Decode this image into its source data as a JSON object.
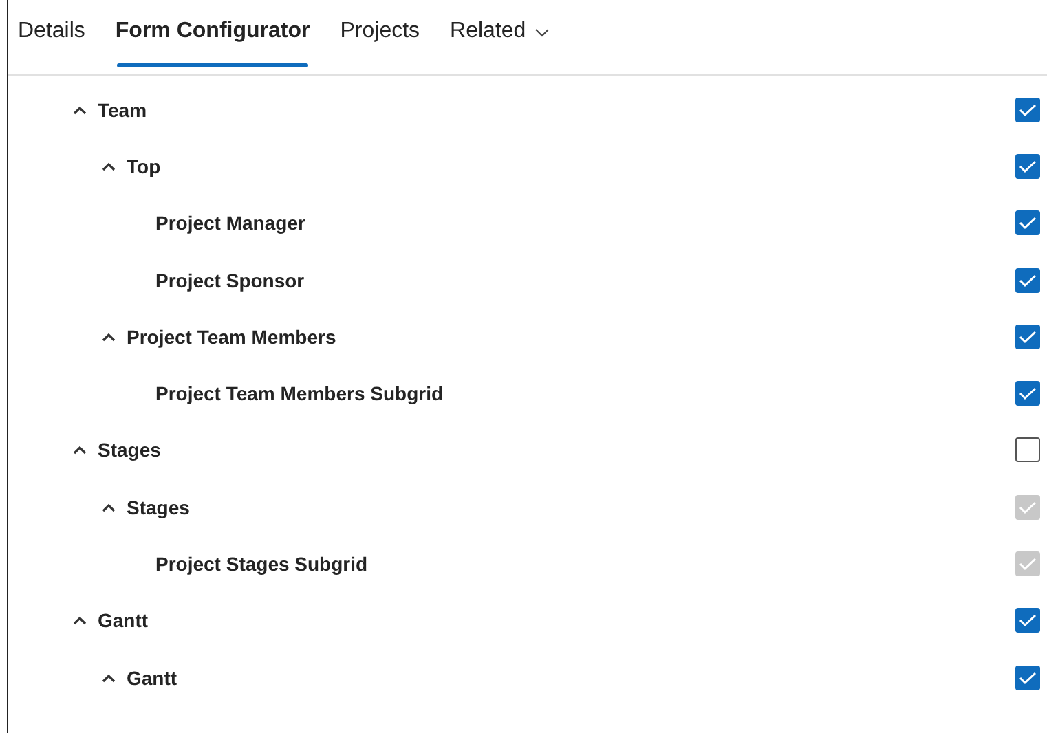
{
  "tabs": [
    {
      "label": "Details",
      "selected": false,
      "has_menu": false
    },
    {
      "label": "Form Configurator",
      "selected": true,
      "has_menu": false
    },
    {
      "label": "Projects",
      "selected": false,
      "has_menu": false
    },
    {
      "label": "Related",
      "selected": false,
      "has_menu": true
    }
  ],
  "tree": [
    {
      "label": "Team",
      "expanded": true,
      "checked": true,
      "disabled": false,
      "children": [
        {
          "label": "Top",
          "expanded": true,
          "checked": true,
          "disabled": false,
          "children": [
            {
              "label": "Project Manager",
              "checked": true,
              "disabled": false
            },
            {
              "label": "Project Sponsor",
              "checked": true,
              "disabled": false
            }
          ]
        },
        {
          "label": "Project Team Members",
          "expanded": true,
          "checked": true,
          "disabled": false,
          "children": [
            {
              "label": "Project Team Members Subgrid",
              "checked": true,
              "disabled": false
            }
          ]
        }
      ]
    },
    {
      "label": "Stages",
      "expanded": true,
      "checked": false,
      "disabled": false,
      "children": [
        {
          "label": "Stages",
          "expanded": true,
          "checked": true,
          "disabled": true,
          "children": [
            {
              "label": "Project Stages Subgrid",
              "checked": true,
              "disabled": true
            }
          ]
        }
      ]
    },
    {
      "label": "Gantt",
      "expanded": true,
      "checked": true,
      "disabled": false,
      "children": [
        {
          "label": "Gantt",
          "expanded": true,
          "checked": true,
          "disabled": false
        }
      ]
    }
  ]
}
